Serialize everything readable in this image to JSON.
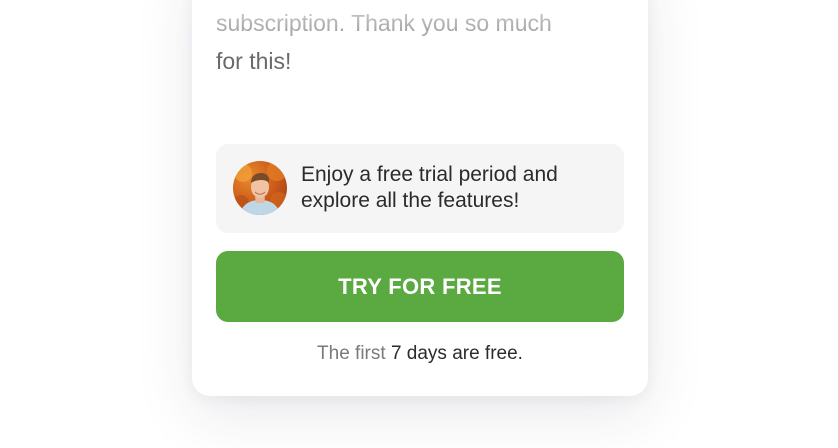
{
  "testimonial": {
    "line_faded": "subscription. Thank you so much",
    "line_last": "for this!"
  },
  "promo": {
    "avatar_icon": "user-avatar",
    "text": "Enjoy a free trial period and explore all the features!"
  },
  "cta": {
    "label": "TRY FOR FREE",
    "color": "#5aaa41"
  },
  "note": {
    "prefix": "The first",
    "highlight": "7 days are free."
  }
}
